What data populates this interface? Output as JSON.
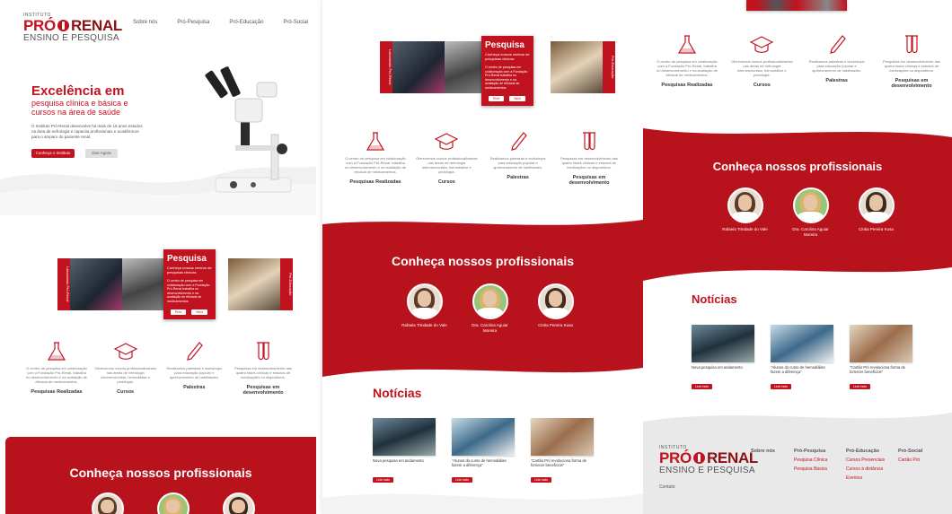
{
  "header": {
    "logo_small": "INSTITUTO",
    "logo_main_left": "PRÓ",
    "logo_main_right": "RENAL",
    "logo_sub": "ENSINO E PESQUISA",
    "nav": [
      "Sobre nós",
      "Pró-Pesquisa",
      "Pró-Educação",
      "Pró-Social"
    ]
  },
  "hero": {
    "title": "Excelência em",
    "subtitle": "pesquisa clínica e básica e cursos na área de saúde",
    "text": "O Instituto Pró-Renal desenvolve há mais de 15 anos estudos na área de nefrologia e capacita profissionais e acadêmicos para o amparo do paciente renal.",
    "primary_button": "Conheça o Instituto",
    "secondary_button": "Doe Agora"
  },
  "carousel": {
    "left_label": "Laboratório Pró-Renal",
    "right_label": "Pró-Educação",
    "card_title": "Pesquisa",
    "card_sub": "Conheça nossos centros de pesquisas clínicas",
    "card_text": "O centro de pesquisa em colaboração com a Fundação Pró-Renal trabalha no desenvolvimento e na avaliação de eficácia de medicamentos.",
    "prev": "Prev",
    "next": "Next"
  },
  "features": [
    {
      "icon": "flask-icon",
      "desc": "O centro de pesquisa em colaboração com a Fundação Pró-Renal, trabalha no desenvolvimento e na avaliação de eficácia de medicamentos.",
      "title": "Pesquisas Realizadas"
    },
    {
      "icon": "graduation-cap-icon",
      "desc": "Oferecemos cursos profissionalizantes nas áreas de nefrologia intervencionista, hemodiálise e pedologia.",
      "title": "Cursos"
    },
    {
      "icon": "pen-icon",
      "desc": "Realizamos palestras e workshops para educação popular e aprimoramento de habilidades.",
      "title": "Palestras"
    },
    {
      "icon": "test-tubes-icon",
      "desc": "Pesquisas em desenvolvimento das quatro fases clínicas e estudos de medicações ou dispositivos.",
      "title": "Pesquisas em desenvolvimento"
    }
  ],
  "professionals": {
    "title": "Conheça nossos profissionais",
    "people": [
      "Rafaela Trindade do Vale",
      "Dra. Carolina Aguiar Moreira",
      "Cintia Pereira Kusa"
    ]
  },
  "news": {
    "title": "Notícias",
    "items": [
      "Nova pesquisa em andamento",
      "\"Alunos do curso de hemodiálise fazem a diferença\"",
      "\"Cartão Pró revoluciona forma de fornecer benefícios\""
    ],
    "read_more": "Leia mais"
  },
  "footer": {
    "contact": "Contato",
    "columns": [
      {
        "head": "Sobre nós",
        "items": []
      },
      {
        "head": "Pró-Pesquisa",
        "items": [
          "Pesquisa Clínica",
          "Pesquisa Básica"
        ]
      },
      {
        "head": "Pró-Educação",
        "items": [
          "Cursos Presenciais",
          "Cursos à distância",
          "Eventos"
        ]
      },
      {
        "head": "Pró-Social",
        "items": [
          "Cartão Pró"
        ]
      }
    ]
  },
  "colors": {
    "brand_red": "#c1121f",
    "band_red": "#b8121c",
    "footer_grey": "#e9e9e9"
  }
}
